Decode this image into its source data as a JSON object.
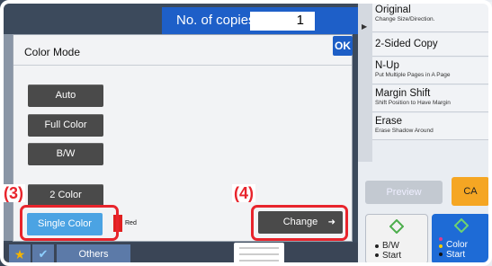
{
  "copies": {
    "label": "No. of copies",
    "value": "1"
  },
  "dialog": {
    "title": "Color Mode",
    "ok_label": "OK",
    "modes": [
      "Auto",
      "Full Color",
      "B/W",
      "2 Color"
    ],
    "single_color_label": "Single Color",
    "selected_color_name": "Red",
    "change_label": "Change"
  },
  "callouts": {
    "step3": "(3)",
    "step4": "(4)"
  },
  "right_panel": {
    "items": [
      {
        "title": "Original",
        "subtitle": "Change Size/Direction."
      },
      {
        "title": "2-Sided Copy",
        "subtitle": ""
      },
      {
        "title": "N-Up",
        "subtitle": "Put Multiple Pages in A Page"
      },
      {
        "title": "Margin Shift",
        "subtitle": "Shift Position to Have Margin"
      },
      {
        "title": "Erase",
        "subtitle": "Erase Shadow Around"
      }
    ],
    "preview_label": "Preview",
    "ca_label": "CA",
    "bw_start_label": [
      "B/W",
      "Start"
    ],
    "color_start_label": [
      "Color",
      "Start"
    ]
  },
  "bottom_bar": {
    "others_label": "Others"
  },
  "colors": {
    "accent_blue": "#1e5fc8",
    "selected_blue": "#4ba3e3",
    "callout_red": "#e8242c",
    "ca_orange": "#f5a623",
    "swatch_red": "#e02020"
  },
  "icons": {
    "favorite": "star-icon",
    "check": "checkmark-icon",
    "arrow": "play-arrow-icon",
    "start": "diamond-start-icon"
  }
}
